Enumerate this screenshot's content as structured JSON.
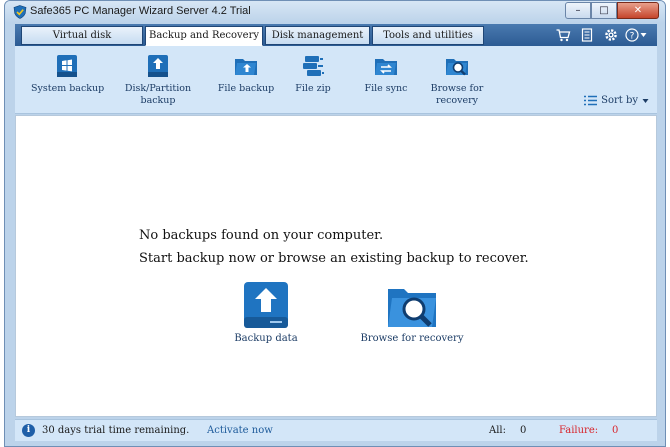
{
  "window": {
    "title": "Safe365 PC Manager Wizard Server 4.2 Trial",
    "controls": {
      "minimize": "–",
      "maximize": "□",
      "close": "✕"
    }
  },
  "tabs": [
    {
      "label": "Virtual disk",
      "active": false
    },
    {
      "label": "Backup and Recovery",
      "active": true
    },
    {
      "label": "Disk management",
      "active": false
    },
    {
      "label": "Tools and utilities",
      "active": false
    }
  ],
  "header_icons": [
    "cart-icon",
    "document-icon",
    "gear-icon",
    "help-icon"
  ],
  "help_glyph": "?",
  "toolbar": {
    "items": [
      {
        "label": "System backup",
        "icon": "system-backup-icon"
      },
      {
        "label": "Disk/Partition\nbackup",
        "icon": "partition-backup-icon"
      },
      {
        "label": "File backup",
        "icon": "file-backup-icon"
      },
      {
        "label": "File zip",
        "icon": "file-zip-icon"
      },
      {
        "label": "File sync",
        "icon": "file-sync-icon"
      },
      {
        "label": "Browse for\nrecovery",
        "icon": "browse-recovery-icon"
      }
    ],
    "sort_label": "Sort by"
  },
  "content": {
    "message_line1": "No backups found on your computer.",
    "message_line2": "Start backup now or browse an existing backup to recover.",
    "backup_action_label": "Backup data",
    "browse_action_label": "Browse for recovery"
  },
  "status": {
    "trial_text": "30 days trial time remaining.",
    "activate_link": "Activate now",
    "all_label": "All:",
    "all_value": "0",
    "failure_label": "Failure:",
    "failure_value": "0"
  },
  "colors": {
    "accent": "#1f6fb8",
    "tab_strip": "#2c5b93",
    "ribbon_bg": "#d3e6f8",
    "failure_red": "#d8232a"
  }
}
